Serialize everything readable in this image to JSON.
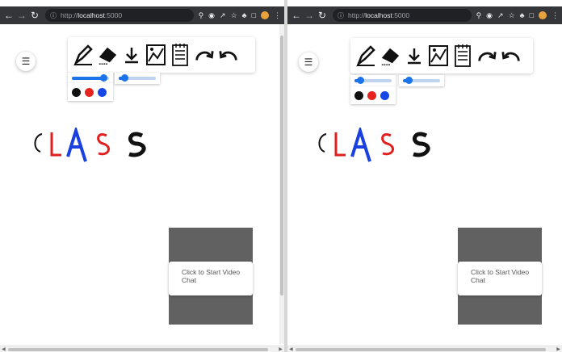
{
  "browser": {
    "url_protocol": "http://",
    "url_host": "localhost",
    "url_port": ":5000"
  },
  "app": {
    "menu_icon": "hamburger-icon",
    "tools": [
      {
        "name": "pencil",
        "icon": "pencil-icon"
      },
      {
        "name": "eraser",
        "icon": "eraser-icon"
      },
      {
        "name": "download",
        "icon": "download-icon"
      },
      {
        "name": "insert-image",
        "icon": "image-icon"
      },
      {
        "name": "notes",
        "icon": "notes-icon"
      },
      {
        "name": "redo",
        "icon": "redo-icon"
      },
      {
        "name": "undo",
        "icon": "undo-icon"
      }
    ],
    "pencil_size_fraction": 0.85,
    "eraser_size_fraction": 0.15,
    "colors": [
      "#111111",
      "#e8231f",
      "#1646e8"
    ],
    "canvas_drawing_text": "CLASS",
    "drawing_letter_colors": [
      "#111111",
      "#e21e1e",
      "#1a40e0",
      "#e21e1e",
      "#111111"
    ],
    "video_chat_button": "Click to Start Video Chat"
  },
  "colors": {
    "chrome_bar": "#35363a",
    "video_panel": "#616161",
    "slider_blue": "#1a73e8"
  }
}
